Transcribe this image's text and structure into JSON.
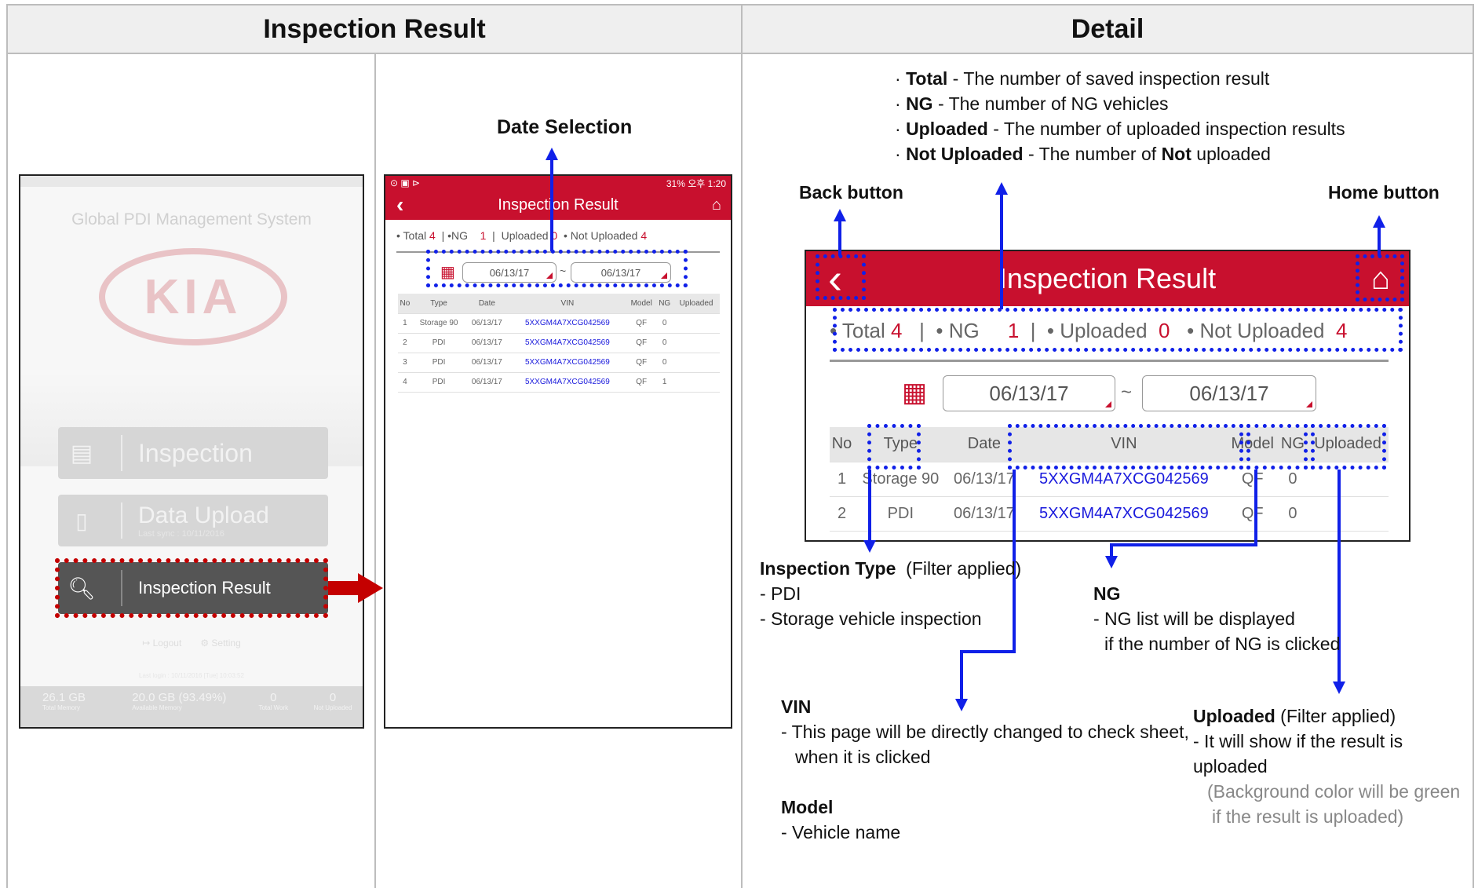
{
  "headers": {
    "left": "Inspection Result",
    "right": "Detail"
  },
  "login_screen": {
    "app_title": "Global PDI Management System",
    "logo_text": "KIA",
    "menu": [
      {
        "label": "Inspection"
      },
      {
        "label": "Data Upload",
        "sub": "Last sync : 10/11/2016"
      },
      {
        "label": "Inspection Result"
      }
    ],
    "logout": "Logout",
    "setting": "Setting",
    "last_login": "Last login : 10/11/2016 [Tue] 10:03:52",
    "stats": [
      {
        "value": "26.1",
        "unit": "GB",
        "label": "Total Memory"
      },
      {
        "value": "20.0",
        "unit": "GB (93.49%)",
        "label": "Available Memory"
      },
      {
        "value": "0",
        "unit": "",
        "label": "Total Work"
      },
      {
        "value": "0",
        "unit": "",
        "label": "Not Uploaded"
      }
    ]
  },
  "small_screen": {
    "annotation": "Date Selection",
    "status_right": "31% 오후 1:20",
    "title": "Inspection Result",
    "summary": {
      "total_label": "Total",
      "total": "4",
      "ng_label": "NG",
      "ng": "1",
      "uploaded_label": "Uploaded",
      "uploaded": "0",
      "not_uploaded_label": "Not Uploaded",
      "not_uploaded": "4"
    },
    "date_from": "06/13/17",
    "date_sep": "~",
    "date_to": "06/13/17",
    "columns": [
      "No",
      "Type",
      "Date",
      "VIN",
      "Model",
      "NG",
      "Uploaded"
    ],
    "rows": [
      [
        "1",
        "Storage 90",
        "06/13/17",
        "5XXGM4A7XCG042569",
        "QF",
        "0",
        ""
      ],
      [
        "2",
        "PDI",
        "06/13/17",
        "5XXGM4A7XCG042569",
        "QF",
        "0",
        ""
      ],
      [
        "3",
        "PDI",
        "06/13/17",
        "5XXGM4A7XCG042569",
        "QF",
        "0",
        ""
      ],
      [
        "4",
        "PDI",
        "06/13/17",
        "5XXGM4A7XCG042569",
        "QF",
        "1",
        ""
      ]
    ]
  },
  "detail": {
    "legend": [
      {
        "term": "Total",
        "text": " - The number of saved inspection result"
      },
      {
        "term": "NG",
        "text": " - The number of NG vehicles"
      },
      {
        "term": "Uploaded",
        "text": " - The number of uploaded inspection results"
      },
      {
        "term": "Not Uploaded",
        "text": " - The number of ",
        "bold2": "Not",
        "text2": " uploaded"
      }
    ],
    "back_label": "Back button",
    "home_label": "Home button",
    "big": {
      "title": "Inspection Result",
      "total_label": "Total",
      "total": "4",
      "ng_label": "NG",
      "ng": "1",
      "uploaded_label": "Uploaded",
      "uploaded": "0",
      "not_uploaded_label": "Not Uploaded",
      "not_uploaded": "4",
      "date_from": "06/13/17",
      "date_sep": "~",
      "date_to": "06/13/17",
      "columns": [
        "No",
        "Type",
        "Date",
        "VIN",
        "Model",
        "NG",
        "Uploaded"
      ],
      "rows": [
        [
          "1",
          "Storage 90",
          "06/13/17",
          "5XXGM4A7XCG042569",
          "QF",
          "0",
          ""
        ],
        [
          "2",
          "PDI",
          "06/13/17",
          "5XXGM4A7XCG042569",
          "QF",
          "0",
          ""
        ]
      ]
    },
    "notes": {
      "type_title": "Inspection Type",
      "type_suffix": "(Filter applied)",
      "type_lines": [
        "- PDI",
        "- Storage vehicle inspection"
      ],
      "ng_title": "NG",
      "ng_lines": [
        "- NG list will be displayed",
        "if the number of NG is clicked"
      ],
      "vin_title": "VIN",
      "vin_lines": [
        "- This page will be directly changed to check sheet,",
        "when it is clicked"
      ],
      "model_title": "Model",
      "model_lines": [
        "- Vehicle name"
      ],
      "uploaded_title": "Uploaded",
      "uploaded_suffix": "(Filter applied)",
      "uploaded_lines": [
        "- It will show if the result is uploaded"
      ],
      "uploaded_gray": [
        "(Background color will be green",
        "if the result is uploaded)"
      ]
    }
  },
  "colors": {
    "brand_red": "#c8102e",
    "annotation_blue": "#1020e8"
  }
}
